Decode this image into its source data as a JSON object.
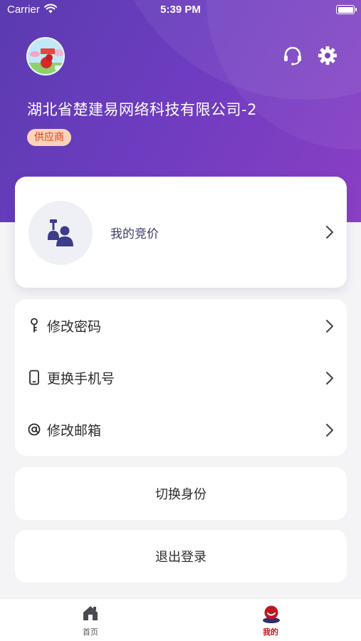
{
  "status_bar": {
    "carrier": "Carrier",
    "time": "5:39 PM"
  },
  "profile": {
    "company_name": "湖北省楚建易网络科技有限公司-2",
    "role": "供应商",
    "avatar_icon": "avatar-image"
  },
  "header_actions": {
    "support_icon": "headset-icon",
    "settings_icon": "gear-icon"
  },
  "bid_card": {
    "label": "我的竞价",
    "icon": "auction-user-icon"
  },
  "menu": {
    "items": [
      {
        "label": "修改密码",
        "icon": "key-icon"
      },
      {
        "label": "更换手机号",
        "icon": "phone-icon"
      },
      {
        "label": "修改邮箱",
        "icon": "at-sign-icon"
      }
    ]
  },
  "actions": {
    "switch_identity": "切换身份",
    "logout": "退出登录"
  },
  "tab_bar": {
    "tabs": [
      {
        "label": "首页",
        "icon": "home-icon",
        "active": false
      },
      {
        "label": "我的",
        "icon": "mine-face-icon",
        "active": true
      }
    ]
  },
  "colors": {
    "header_gradient_start": "#5a3bb0",
    "header_gradient_end": "#8a3fc4",
    "badge_bg": "#fbd2ba",
    "badge_text": "#e2421a",
    "active_tab": "#c0161e",
    "page_bg": "#f4f4f6"
  }
}
